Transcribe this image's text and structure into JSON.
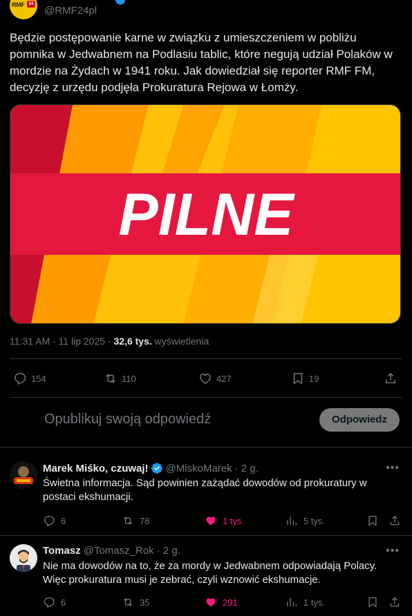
{
  "post": {
    "handle": "@RMF24pl",
    "avatar_text": "RMF",
    "avatar_badge": "24",
    "text": "Będzie postępowanie karne w związku z umieszczeniem w pobliżu pomnika w Jedwabnem na Podlasiu tablic, które negują udział Polaków w mordzie na Żydach w 1941 roku. Jak dowiedział się reporter RMF FM, decyzję z urzędu podjęła Prokuratura Rejowa w Łomży.",
    "image_text": "PILNE",
    "time": "11:31 AM",
    "date": "11 lip 2025",
    "views": "32,6 tys.",
    "views_label": "wyświetlenia",
    "separator": "·",
    "replies": "154",
    "reposts": "110",
    "likes": "427",
    "bookmarks": "19"
  },
  "compose": {
    "placeholder": "Opublikuj swoją odpowiedź",
    "button": "Odpowiedz"
  },
  "replies": [
    {
      "name": "Marek Miśko, czuwaj!",
      "handle": "@MiskoMarek",
      "age": "· 2 g.",
      "text": "Świetna informacja. Sąd powinien zażądać dowodów od prokuratury w postaci ekshumacji.",
      "replies": "6",
      "reposts": "78",
      "likes": "1 tys.",
      "views": "5 tys."
    },
    {
      "name": "Tomasz",
      "handle": "@Tomasz_Rok",
      "age": "· 2 g.",
      "text": "Nie ma dowodów na to, że za mordy w Jedwabnem odpowiadają Polacy. Więc prokuratura musi je zebrać, czyli wznowić ekshumacje.",
      "replies": "6",
      "reposts": "35",
      "likes": "291",
      "views": "1 tys."
    }
  ],
  "colors": {
    "accent_like": "#f91880",
    "muted": "#71767b",
    "verified": "#1d9bf0",
    "pilne_red": "#e5173f",
    "pilne_yellow": "#ffc400"
  }
}
